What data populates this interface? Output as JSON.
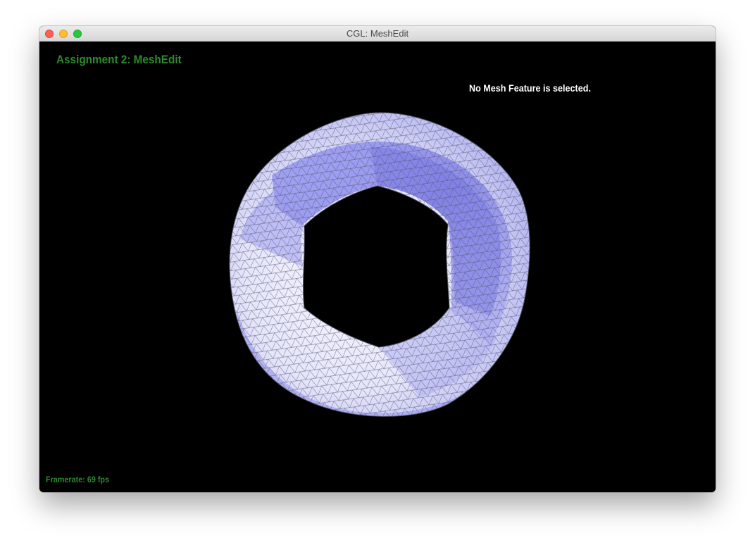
{
  "window": {
    "title": "CGL: MeshEdit"
  },
  "overlay": {
    "assignment_title": "Assignment 2: MeshEdit",
    "selection_status": "No Mesh Feature is selected.",
    "framerate": "Framerate: 69 fps"
  },
  "colors": {
    "background": "#000000",
    "overlay_green": "#2e8b2e",
    "status_white": "#ffffff",
    "mesh_light": "#eeeeff",
    "mesh_shadow": "#8a8af0",
    "wireframe": "#555566"
  },
  "icons": {
    "close": "close-button-icon",
    "minimize": "minimize-button-icon",
    "maximize": "maximize-button-icon"
  }
}
